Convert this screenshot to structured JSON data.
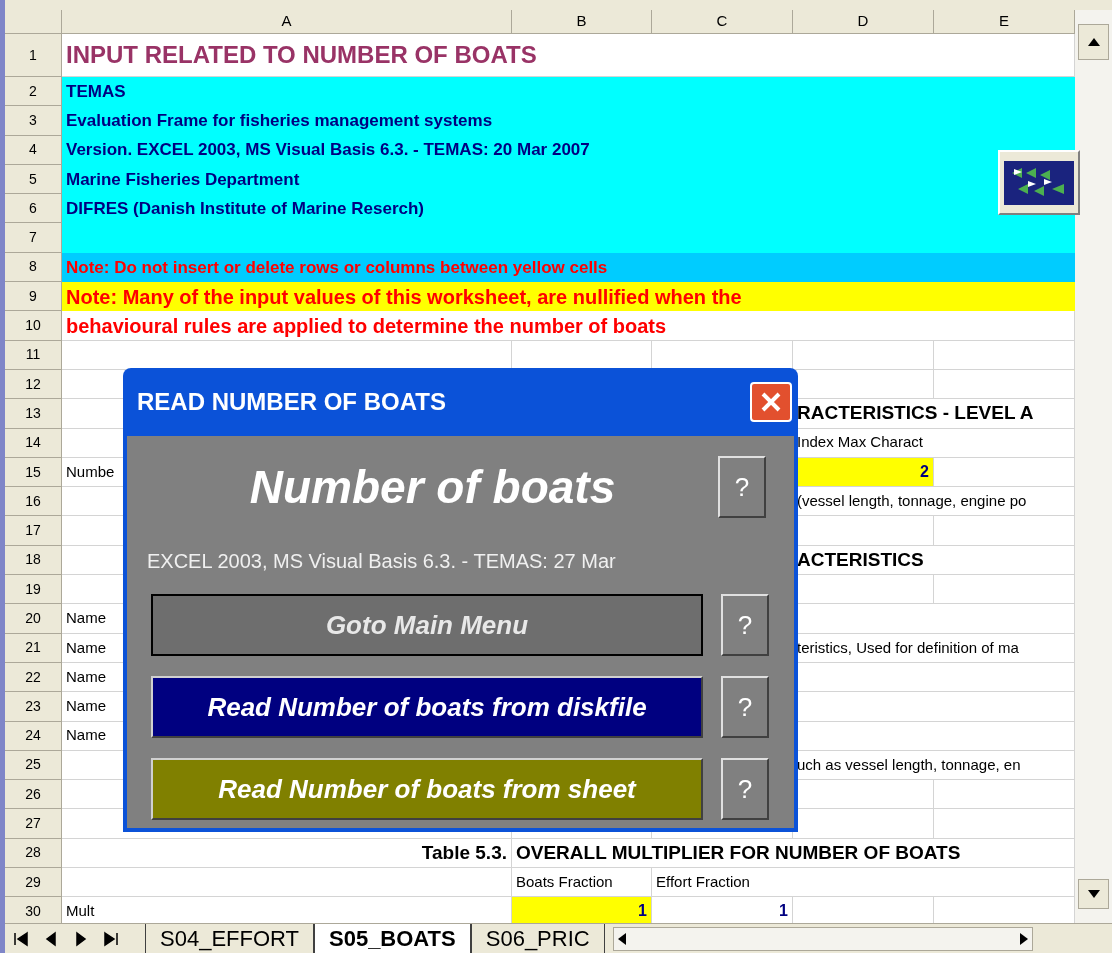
{
  "column_headers": [
    "A",
    "B",
    "C",
    "D",
    "E"
  ],
  "rows": [
    {
      "number": "1",
      "kind": "plain",
      "A": {
        "text": "INPUT RELATED TO NUMBER OF BOATS",
        "kind": "title",
        "highlighted": false
      }
    },
    {
      "number": "2",
      "kind": "info-band",
      "A": {
        "text": "TEMAS",
        "kind": "info"
      }
    },
    {
      "number": "3",
      "kind": "info-band",
      "A": {
        "text": "Evaluation Frame for fisheries management systems",
        "kind": "info"
      }
    },
    {
      "number": "4",
      "kind": "info-band",
      "A": {
        "text": "Version. EXCEL 2003, MS Visual Basis 6.3. - TEMAS: 20 Mar 2007",
        "kind": "info"
      }
    },
    {
      "number": "5",
      "kind": "info-band",
      "A": {
        "text": "Marine Fisheries Department",
        "kind": "info"
      }
    },
    {
      "number": "6",
      "kind": "info-band",
      "A": {
        "text": "DIFRES (Danish Institute of Marine Reserch)",
        "kind": "info"
      }
    },
    {
      "number": "7",
      "kind": "info-band"
    },
    {
      "number": "8",
      "kind": "notice-band",
      "A": {
        "text": "Note: Do not insert or delete rows or columns between yellow cells",
        "kind": "note-small"
      }
    },
    {
      "number": "9",
      "kind": "warning-band",
      "A": {
        "text": "Note: Many of the input values of this worksheet, are nullified when the",
        "kind": "note-large"
      }
    },
    {
      "number": "10",
      "kind": "plain",
      "A": {
        "text": "behavioural rules are applied to determine the number of boats",
        "kind": "note-large",
        "highlighted": false
      }
    },
    {
      "number": "11",
      "kind": "plain"
    },
    {
      "number": "12",
      "kind": "plain"
    },
    {
      "number": "13",
      "kind": "plain",
      "D": {
        "text": "RACTERISTICS - LEVEL A",
        "kind": "heading",
        "highlighted": false
      }
    },
    {
      "number": "14",
      "kind": "plain",
      "D": {
        "text": "Index Max Charact",
        "kind": "plain",
        "highlighted": false
      }
    },
    {
      "number": "15",
      "kind": "plain",
      "A": {
        "text": "Numbe",
        "kind": "plain",
        "highlighted": false
      },
      "D": {
        "text": "2",
        "kind": "value",
        "highlighted": true
      }
    },
    {
      "number": "16",
      "kind": "plain",
      "D": {
        "text": "(vessel length, tonnage, engine po",
        "kind": "plain",
        "highlighted": false
      }
    },
    {
      "number": "17",
      "kind": "plain"
    },
    {
      "number": "18",
      "kind": "plain",
      "D": {
        "text": "ACTERISTICS",
        "kind": "heading",
        "highlighted": false
      }
    },
    {
      "number": "19",
      "kind": "plain"
    },
    {
      "number": "20",
      "kind": "plain",
      "A": {
        "text": "Name",
        "kind": "plain",
        "highlighted": false
      }
    },
    {
      "number": "21",
      "kind": "plain",
      "A": {
        "text": "Name",
        "kind": "plain",
        "highlighted": false
      },
      "D": {
        "text": "teristics, Used for definition of ma",
        "kind": "plain",
        "highlighted": false
      }
    },
    {
      "number": "22",
      "kind": "plain",
      "A": {
        "text": "Name",
        "kind": "plain",
        "highlighted": false
      }
    },
    {
      "number": "23",
      "kind": "plain",
      "A": {
        "text": "Name",
        "kind": "plain",
        "highlighted": false
      }
    },
    {
      "number": "24",
      "kind": "plain",
      "A": {
        "text": "Name",
        "kind": "plain",
        "highlighted": false
      }
    },
    {
      "number": "25",
      "kind": "plain",
      "D": {
        "text": "uch as vessel length, tonnage, en",
        "kind": "plain",
        "highlighted": false
      }
    },
    {
      "number": "26",
      "kind": "plain"
    },
    {
      "number": "27",
      "kind": "plain"
    },
    {
      "number": "28",
      "kind": "plain",
      "A": {
        "text": "Table 5.3.",
        "kind": "caption",
        "highlighted": false
      },
      "B": {
        "text": "OVERALL MULTIPLIER FOR NUMBER OF BOATS",
        "kind": "heading",
        "highlighted": false
      }
    },
    {
      "number": "29",
      "kind": "plain",
      "B": {
        "text": "Boats Fraction",
        "kind": "plain",
        "highlighted": false
      },
      "C": {
        "text": "Effort Fraction",
        "kind": "plain",
        "highlighted": false
      }
    },
    {
      "number": "30",
      "kind": "plain",
      "A": {
        "text": "Mult",
        "kind": "plain",
        "highlighted": false
      },
      "B": {
        "text": "1",
        "kind": "value",
        "highlighted": true
      },
      "C": {
        "text": "1",
        "kind": "value",
        "highlighted": false
      }
    }
  ],
  "dialog": {
    "title": "READ NUMBER OF BOATS",
    "heading": "Number of boats",
    "heading_help": "?",
    "subtitle": "EXCEL 2003, MS Visual Basis 6.3. - TEMAS: 27 Mar",
    "buttons": [
      {
        "label": "Goto Main Menu",
        "kind": "default",
        "help": "?"
      },
      {
        "label": "Read  Number of boats from diskfile",
        "kind": "navy",
        "help": "?"
      },
      {
        "label": "Read Number of boats from sheet",
        "kind": "olive",
        "help": "?"
      }
    ]
  },
  "sheet_tabs": [
    {
      "label": "S04_EFFORT",
      "selected": false
    },
    {
      "label": "S05_BOATS",
      "selected": true
    },
    {
      "label": "S06_PRIC",
      "selected": false
    }
  ]
}
